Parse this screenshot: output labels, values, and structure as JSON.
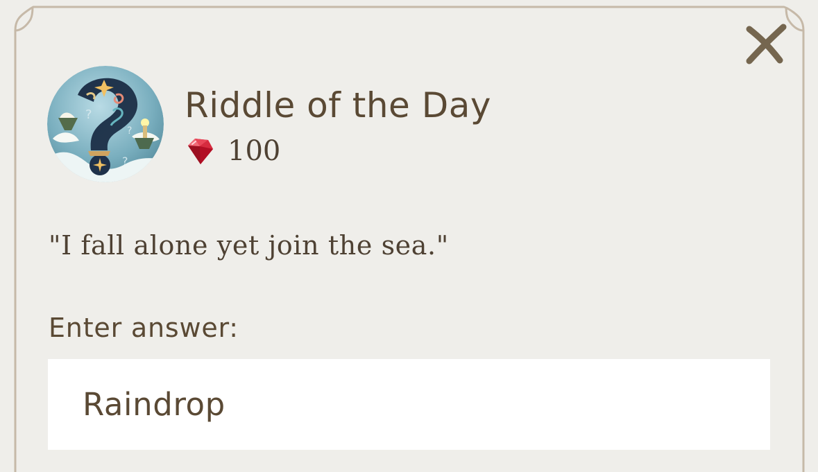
{
  "dialog": {
    "title": "Riddle of the Day",
    "reward": {
      "icon": "ruby-gem-icon",
      "amount": "100"
    },
    "riddle_text": "\"I fall alone yet join the sea.\"",
    "answer_label": "Enter answer:",
    "answer_value": "Raindrop",
    "close_icon": "close-icon"
  },
  "theme": {
    "background": "#efeeea",
    "frame": "#c6b9a8",
    "text": "#5a4934",
    "gem": "#c6152a",
    "close": "#75664f"
  }
}
